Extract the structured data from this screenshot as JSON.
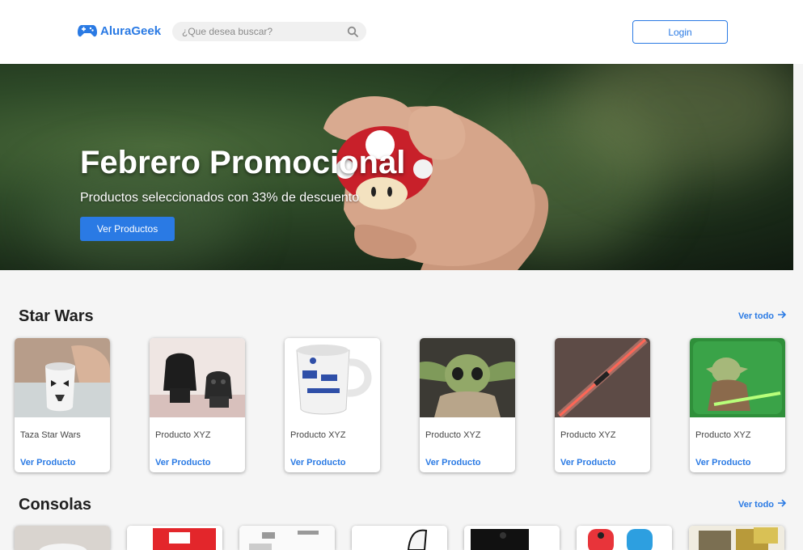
{
  "header": {
    "logo_text": "AluraGeek",
    "search_placeholder": "¿Que desea buscar?",
    "login_label": "Login"
  },
  "hero": {
    "title": "Febrero Promocional",
    "subtitle": "Productos seleccionados con 33% de descuento",
    "button_label": "Ver Productos"
  },
  "sections": [
    {
      "title": "Star Wars",
      "see_all": "Ver todo",
      "products": [
        {
          "name": "Taza Star Wars",
          "link": "Ver Producto",
          "image": "stormtrooper-mug"
        },
        {
          "name": "Producto XYZ",
          "link": "Ver Producto",
          "image": "darth-vader-lego"
        },
        {
          "name": "Producto XYZ",
          "link": "Ver Producto",
          "image": "r2d2-mug"
        },
        {
          "name": "Producto XYZ",
          "link": "Ver Producto",
          "image": "baby-yoda"
        },
        {
          "name": "Producto XYZ",
          "link": "Ver Producto",
          "image": "lightsaber"
        },
        {
          "name": "Producto XYZ",
          "link": "Ver Producto",
          "image": "yoda-mousepad"
        }
      ]
    },
    {
      "title": "Consolas",
      "see_all": "Ver todo",
      "products": [
        {
          "image": "controller"
        },
        {
          "image": "nintendo-switch-box"
        },
        {
          "image": "game-disk-diagram"
        },
        {
          "image": "playstation-5"
        },
        {
          "image": "xbox-series-x"
        },
        {
          "image": "joy-con"
        },
        {
          "image": "gameboy-cartridges"
        }
      ]
    }
  ],
  "colors": {
    "accent": "#2a7ae4",
    "background": "#f5f5f5",
    "header": "#ffffff"
  }
}
